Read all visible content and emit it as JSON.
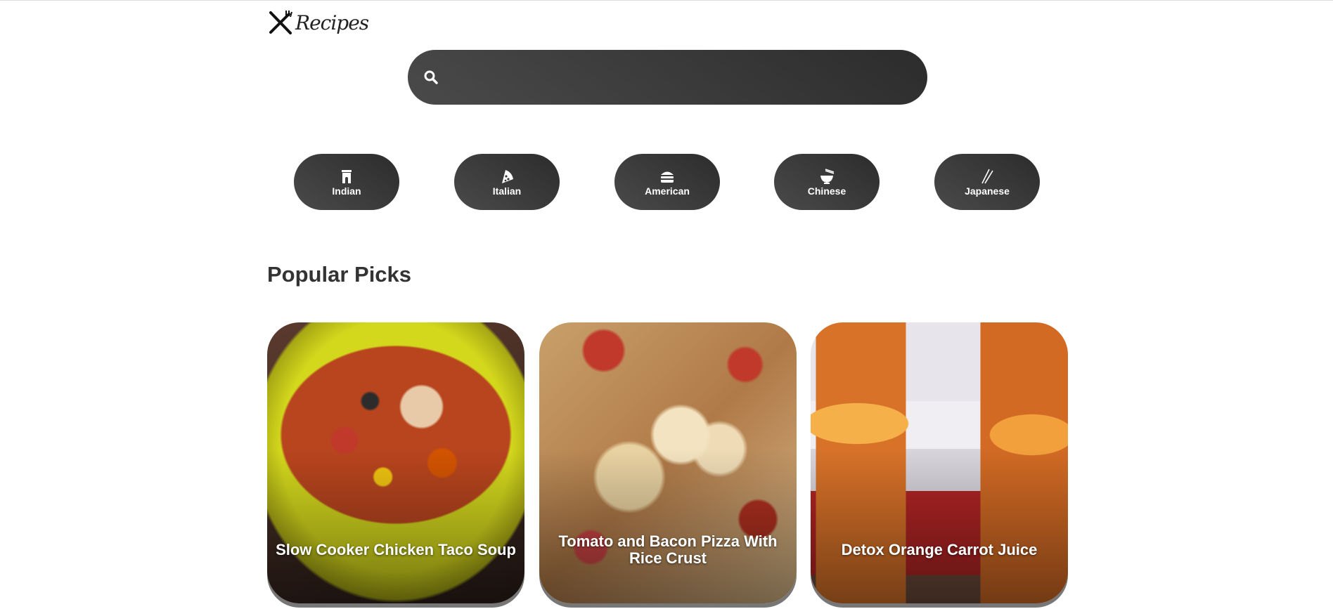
{
  "header": {
    "logo_text": "Recipes"
  },
  "search": {
    "value": "",
    "placeholder": ""
  },
  "categories": [
    {
      "label": "Indian",
      "icon": "gate-icon"
    },
    {
      "label": "Italian",
      "icon": "pizza-icon"
    },
    {
      "label": "American",
      "icon": "burger-icon"
    },
    {
      "label": "Chinese",
      "icon": "ramen-bowl-icon"
    },
    {
      "label": "Japanese",
      "icon": "chopsticks-icon"
    }
  ],
  "popular": {
    "title": "Popular Picks",
    "cards": [
      {
        "title": "Slow Cooker Chicken Taco Soup"
      },
      {
        "title": "Tomato and Bacon Pizza With Rice Crust"
      },
      {
        "title": "Detox Orange Carrot Juice"
      }
    ]
  },
  "colors": {
    "button_bg": "#3a3a3a",
    "text": "#333333",
    "background": "#ffffff"
  }
}
